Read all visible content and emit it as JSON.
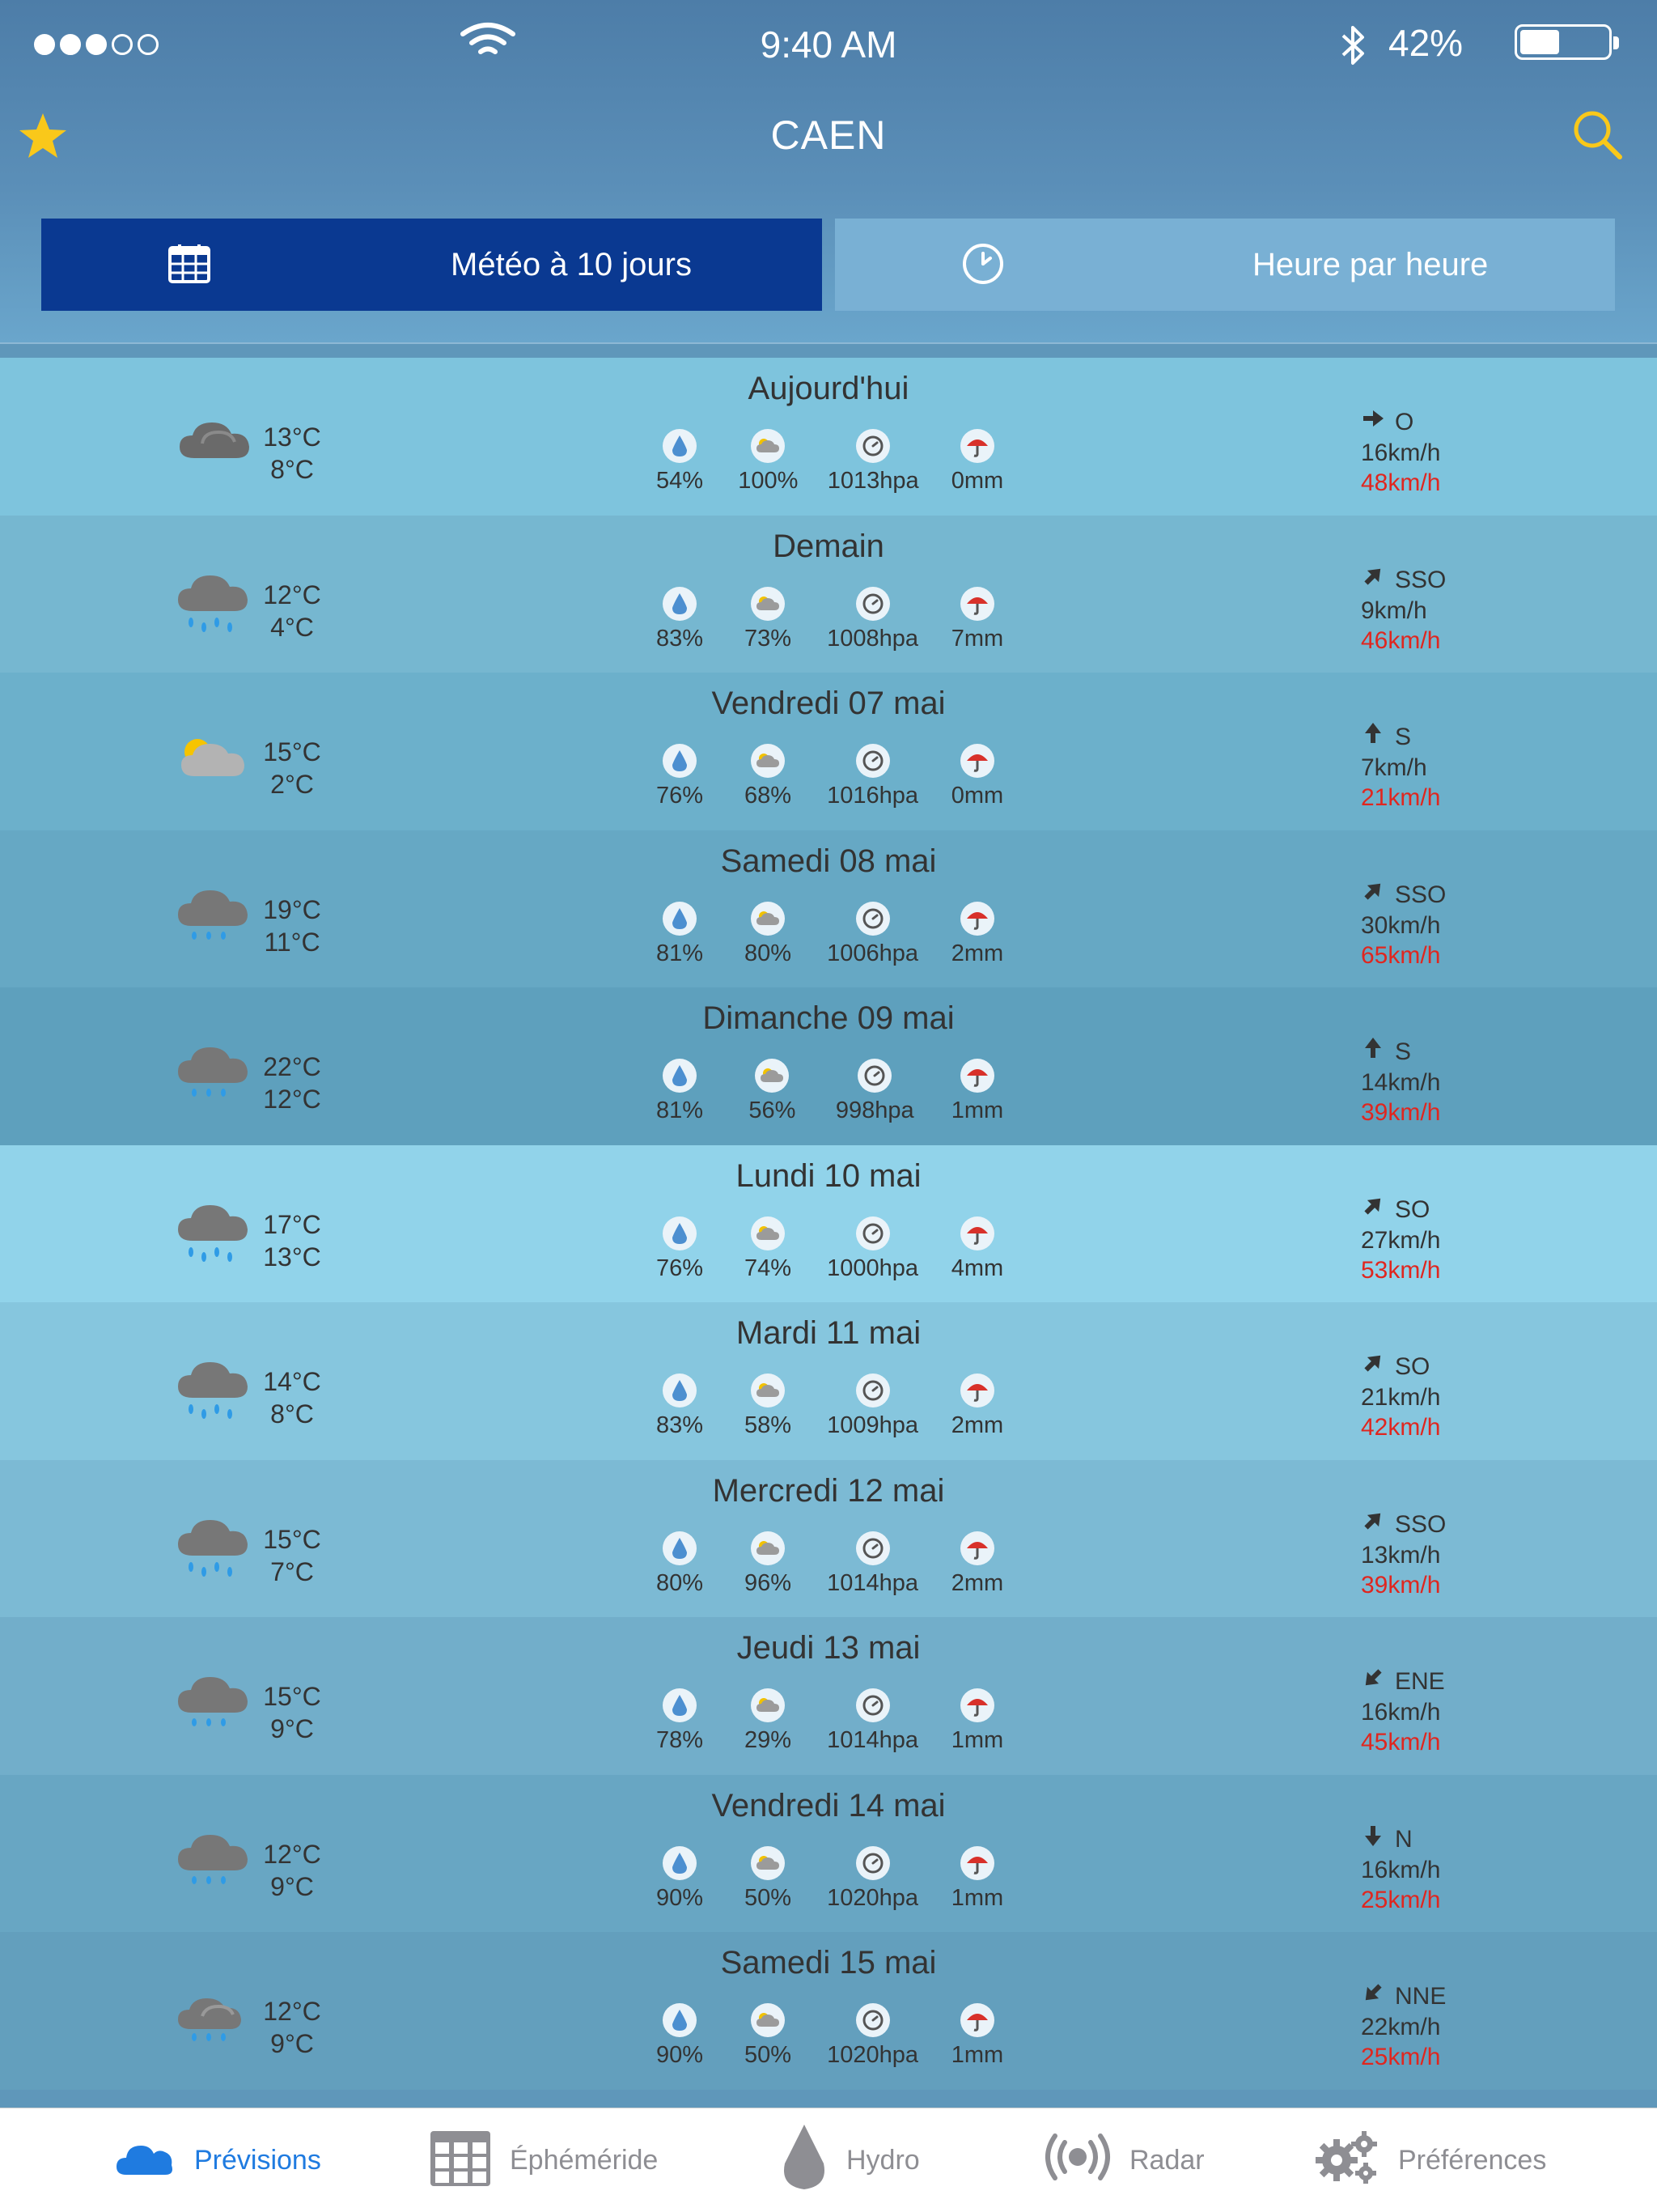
{
  "status": {
    "time": "9:40 AM",
    "battery": "42%",
    "signal_bars": 3,
    "signal_total": 5
  },
  "header": {
    "city": "CAEN"
  },
  "tabs": {
    "forecast10": "Météo à 10 jours",
    "hourly": "Heure par heure"
  },
  "colors": {
    "active_tab": "#0a3991",
    "inactive_tab": "#79b0d4",
    "gust": "#e0261f",
    "accent": "#1f7be0"
  },
  "days": [
    {
      "title": "Aujourd'hui",
      "icon": "cloudy-icon",
      "max": "13°C",
      "min": "8°C",
      "humidity": "54%",
      "cloud": "100%",
      "pressure": "1013hpa",
      "rain": "0mm",
      "arrow": "arrow-east-icon",
      "wind_dir": "O",
      "wind": "16km/h",
      "gust": "48km/h"
    },
    {
      "title": "Demain",
      "icon": "rain-cloud-icon",
      "max": "12°C",
      "min": "4°C",
      "humidity": "83%",
      "cloud": "73%",
      "pressure": "1008hpa",
      "rain": "7mm",
      "arrow": "arrow-northeast-icon",
      "wind_dir": "SSO",
      "wind": "9km/h",
      "gust": "46km/h"
    },
    {
      "title": "Vendredi 07 mai",
      "icon": "partly-cloudy-icon",
      "max": "15°C",
      "min": "2°C",
      "humidity": "76%",
      "cloud": "68%",
      "pressure": "1016hpa",
      "rain": "0mm",
      "arrow": "arrow-north-icon",
      "wind_dir": "S",
      "wind": "7km/h",
      "gust": "21km/h"
    },
    {
      "title": "Samedi 08 mai",
      "icon": "light-rain-icon",
      "max": "19°C",
      "min": "11°C",
      "humidity": "81%",
      "cloud": "80%",
      "pressure": "1006hpa",
      "rain": "2mm",
      "arrow": "arrow-northeast-icon",
      "wind_dir": "SSO",
      "wind": "30km/h",
      "gust": "65km/h"
    },
    {
      "title": "Dimanche 09 mai",
      "icon": "light-rain-icon",
      "max": "22°C",
      "min": "12°C",
      "humidity": "81%",
      "cloud": "56%",
      "pressure": "998hpa",
      "rain": "1mm",
      "arrow": "arrow-north-icon",
      "wind_dir": "S",
      "wind": "14km/h",
      "gust": "39km/h"
    },
    {
      "title": "Lundi 10 mai",
      "icon": "rain-cloud-icon",
      "max": "17°C",
      "min": "13°C",
      "humidity": "76%",
      "cloud": "74%",
      "pressure": "1000hpa",
      "rain": "4mm",
      "arrow": "arrow-northeast-icon",
      "wind_dir": "SO",
      "wind": "27km/h",
      "gust": "53km/h"
    },
    {
      "title": "Mardi 11 mai",
      "icon": "rain-cloud-icon",
      "max": "14°C",
      "min": "8°C",
      "humidity": "83%",
      "cloud": "58%",
      "pressure": "1009hpa",
      "rain": "2mm",
      "arrow": "arrow-northeast-icon",
      "wind_dir": "SO",
      "wind": "21km/h",
      "gust": "42km/h"
    },
    {
      "title": "Mercredi 12 mai",
      "icon": "rain-cloud-icon",
      "max": "15°C",
      "min": "7°C",
      "humidity": "80%",
      "cloud": "96%",
      "pressure": "1014hpa",
      "rain": "2mm",
      "arrow": "arrow-northeast-icon",
      "wind_dir": "SSO",
      "wind": "13km/h",
      "gust": "39km/h"
    },
    {
      "title": "Jeudi 13 mai",
      "icon": "light-rain-icon",
      "max": "15°C",
      "min": "9°C",
      "humidity": "78%",
      "cloud": "29%",
      "pressure": "1014hpa",
      "rain": "1mm",
      "arrow": "arrow-southwest-icon",
      "wind_dir": "ENE",
      "wind": "16km/h",
      "gust": "45km/h"
    },
    {
      "title": "Vendredi 14 mai",
      "icon": "light-rain-icon",
      "max": "12°C",
      "min": "9°C",
      "humidity": "90%",
      "cloud": "50%",
      "pressure": "1020hpa",
      "rain": "1mm",
      "arrow": "arrow-south-icon",
      "wind_dir": "N",
      "wind": "16km/h",
      "gust": "25km/h"
    },
    {
      "title": "Samedi 15 mai",
      "icon": "cloudy-light-rain-icon",
      "max": "12°C",
      "min": "9°C",
      "humidity": "90%",
      "cloud": "50%",
      "pressure": "1020hpa",
      "rain": "1mm",
      "arrow": "arrow-southwest-icon",
      "wind_dir": "NNE",
      "wind": "22km/h",
      "gust": "25km/h"
    }
  ],
  "bottom_tabs": {
    "forecast": "Prévisions",
    "ephemeris": "Éphéméride",
    "hydro": "Hydro",
    "radar": "Radar",
    "prefs": "Préférences"
  }
}
